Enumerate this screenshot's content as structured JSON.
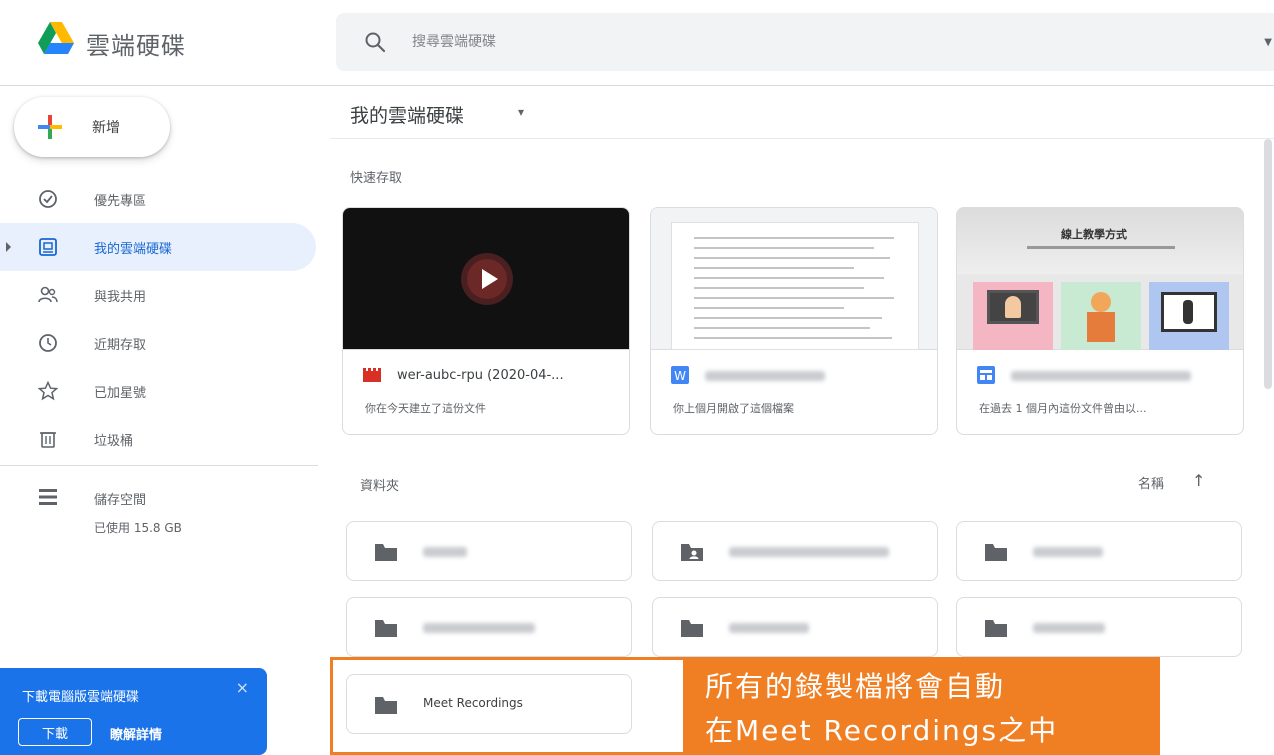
{
  "header": {
    "app_title": "雲端硬碟",
    "search_placeholder": "搜尋雲端硬碟"
  },
  "sidebar": {
    "new_label": "新增",
    "items": [
      {
        "label": "優先專區",
        "icon": "priority-icon"
      },
      {
        "label": "我的雲端硬碟",
        "icon": "my-drive-icon",
        "active": true
      },
      {
        "label": "與我共用",
        "icon": "shared-icon"
      },
      {
        "label": "近期存取",
        "icon": "clock-icon"
      },
      {
        "label": "已加星號",
        "icon": "star-icon"
      },
      {
        "label": "垃圾桶",
        "icon": "trash-icon"
      }
    ],
    "storage": {
      "label": "儲存空間",
      "used": "已使用 15.8 GB"
    },
    "promo": {
      "text": "下載電腦版雲端硬碟",
      "download_label": "下載",
      "learn_label": "瞭解詳情",
      "close_glyph": "×"
    }
  },
  "main": {
    "title": "我的雲端硬碟",
    "title_caret": "▾",
    "quick_access_label": "快速存取",
    "cards": [
      {
        "name": "wer-aubc-rpu (2020-04-...",
        "desc": "你在今天建立了這份文件",
        "type": "video"
      },
      {
        "name": "",
        "desc": "你上個月開啟了這個檔案",
        "type": "word"
      },
      {
        "name": "",
        "desc": "在過去 1 個月內這份文件曾由以...",
        "type": "slides",
        "thumb_title": "線上教學方式"
      }
    ],
    "folders_label": "資料夾",
    "sort_label": "名稱",
    "sort_arrow": "↑",
    "folders": [
      {
        "name": "",
        "shared": false
      },
      {
        "name": "",
        "shared": true
      },
      {
        "name": "",
        "shared": false
      },
      {
        "name": "",
        "shared": false
      },
      {
        "name": "",
        "shared": false
      },
      {
        "name": "",
        "shared": false
      },
      {
        "name": "Meet Recordings",
        "shared": false
      }
    ]
  },
  "callout": {
    "line1": "所有的錄製檔將會自動",
    "line2": "在Meet Recordings之中"
  },
  "colors": {
    "accent": "#1a73e8",
    "active_bg": "#e8f0fe",
    "callout": "#f07f24"
  }
}
